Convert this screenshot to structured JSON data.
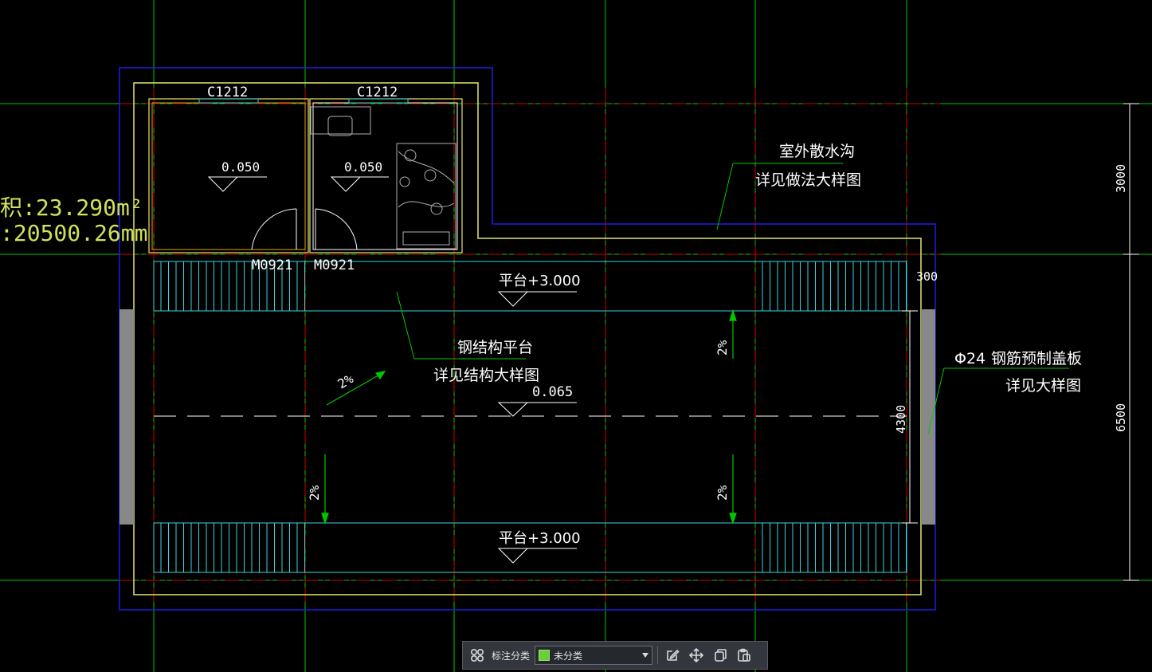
{
  "drawing": {
    "windows": [
      "C1212",
      "C1212"
    ],
    "doors": [
      "M0921",
      "M0921"
    ],
    "room_levels": [
      "0.050",
      "0.050"
    ],
    "area_text": "积:23.290m²",
    "length_text": ":20500.26mm",
    "callout_ditch": [
      "室外散水沟",
      "详见做法大样图"
    ],
    "callout_steel": [
      "钢结构平台",
      "详见结构大样图"
    ],
    "callout_cover_prefix": "Φ24",
    "callout_cover": [
      "钢筋预制盖板",
      "详见大样图"
    ],
    "platform_levels": [
      "平台+3.000",
      "平台+3.000"
    ],
    "floor_level": "0.065",
    "slopes": [
      "2%",
      "2%",
      "2%",
      "2%"
    ],
    "dimensions": {
      "d300": "300",
      "d4300": "4300",
      "d3000": "3000",
      "d6500": "6500"
    }
  },
  "toolbar": {
    "label": "标注分类",
    "selected": "未分类",
    "swatch_color": "#6ad03a"
  },
  "colors": {
    "background": "#000000",
    "grid_green": "#00c800",
    "axis_red": "#c80000",
    "wall_yellow": "#e6e66e",
    "outline_blue": "#1e1ee6",
    "stair_cyan": "#3cd2dc",
    "text_white": "#ffffff",
    "area_yellow": "#d2e15a"
  }
}
